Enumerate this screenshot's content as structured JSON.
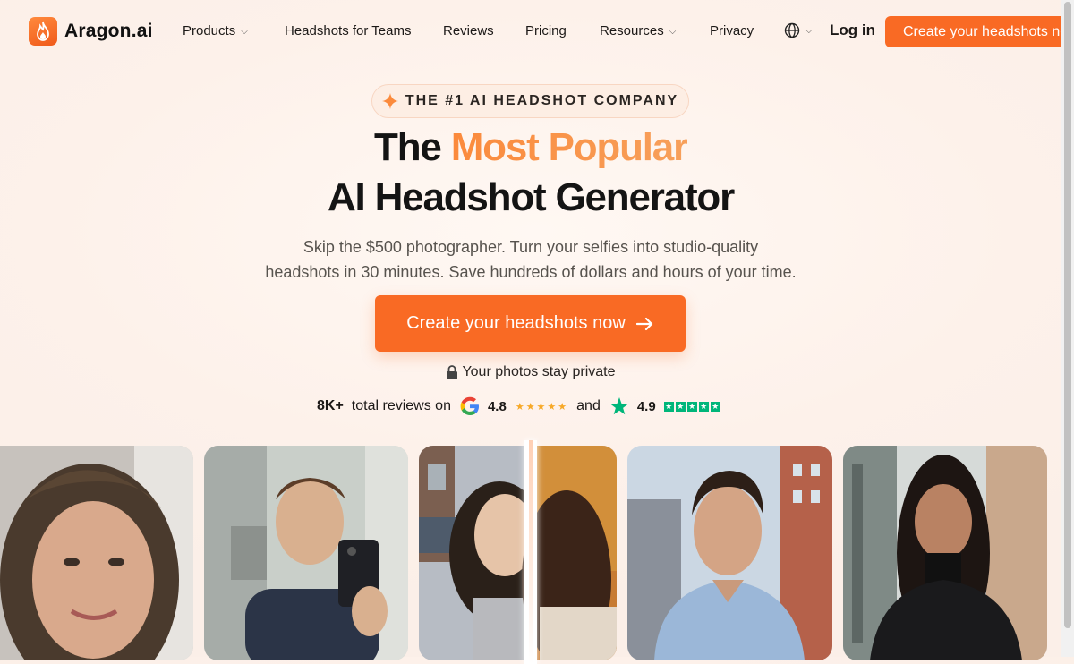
{
  "brand": {
    "name": "Aragon.ai",
    "logo_icon": "flame-icon",
    "accent_color": "#f96a24"
  },
  "nav": {
    "items": [
      {
        "label": "Products",
        "has_dropdown": true
      },
      {
        "label": "Headshots for Teams",
        "has_dropdown": false
      },
      {
        "label": "Reviews",
        "has_dropdown": false
      },
      {
        "label": "Pricing",
        "has_dropdown": false
      },
      {
        "label": "Resources",
        "has_dropdown": true
      },
      {
        "label": "Privacy",
        "has_dropdown": false
      }
    ],
    "language_icon": "globe-icon",
    "login_label": "Log in",
    "cta_label": "Create your headshots now"
  },
  "hero": {
    "badge": "THE #1 AI HEADSHOT COMPANY",
    "badge_icon": "sparkle-icon",
    "title_prefix": "The",
    "title_accent": "Most Popular",
    "title_line2": "AI Headshot Generator",
    "subtitle_line1": "Skip the $500 photographer. Turn your selfies into studio-quality",
    "subtitle_line2": "headshots in 30 minutes. Save hundreds of dollars and hours of your time.",
    "cta_label": "Create your headshots now",
    "cta_icon": "arrow-right-icon",
    "privacy_note": "Your photos stay private",
    "privacy_icon": "lock-icon"
  },
  "reviews": {
    "count": "8K+",
    "text": "total reviews on",
    "google_rating": "4.8",
    "google_stars": 5,
    "connector": "and",
    "trustpilot_rating": "4.9",
    "trustpilot_stars": 5
  },
  "gallery": {
    "photos": [
      {
        "kind": "selfie",
        "subject": "woman with long brown hair"
      },
      {
        "kind": "selfie",
        "subject": "man taking mirror selfie"
      },
      {
        "kind": "before-after",
        "subject": "woman with long dark hair"
      },
      {
        "kind": "headshot",
        "subject": "man in blue shirt, city street"
      },
      {
        "kind": "headshot",
        "subject": "woman in black blazer, office"
      }
    ]
  }
}
